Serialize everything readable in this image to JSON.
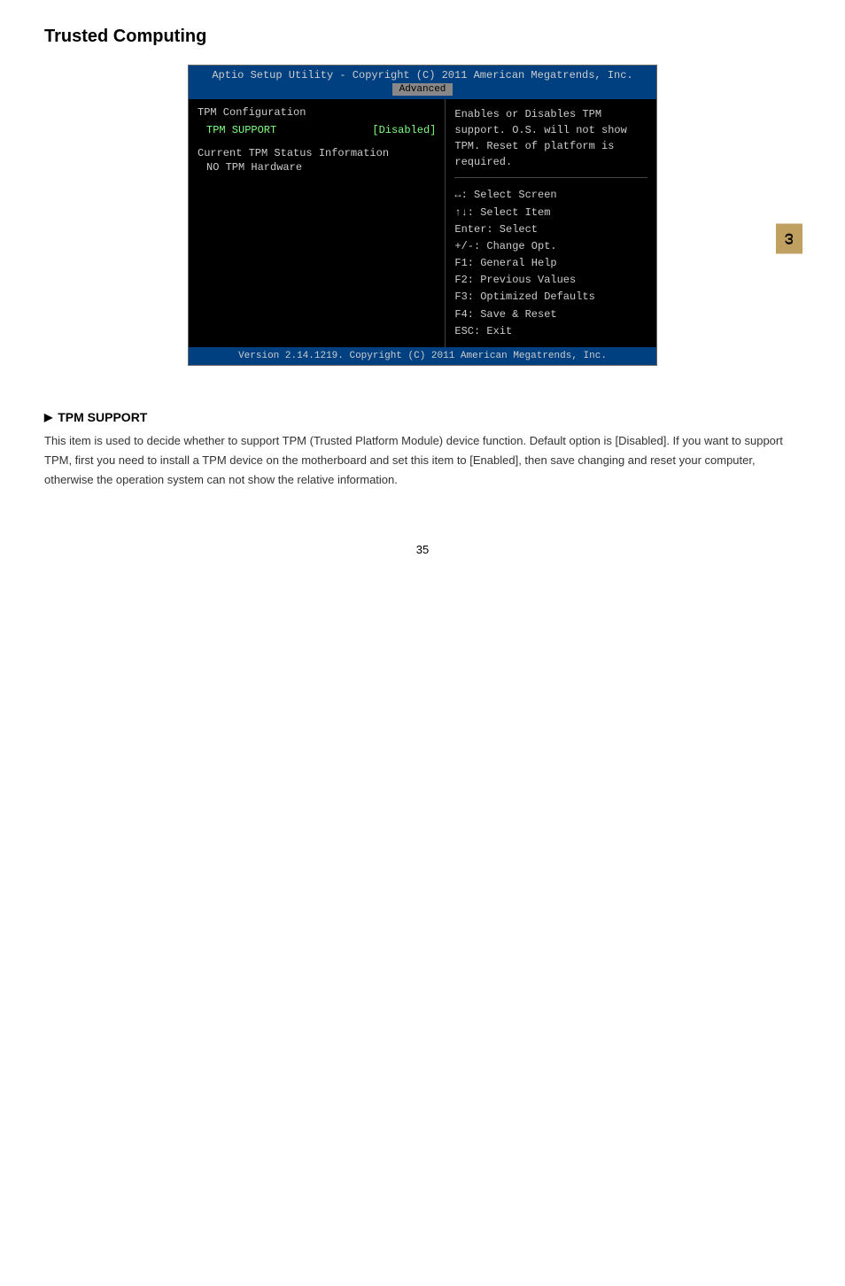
{
  "page": {
    "title": "Trusted Computing",
    "side_tab_label": "ω",
    "page_number": "35"
  },
  "bios": {
    "header_title": "Aptio Setup Utility - Copyright (C) 2011 American Megatrends, Inc.",
    "active_tab": "Advanced",
    "left_panel": {
      "section_title": "TPM Configuration",
      "tpm_support_label": "TPM SUPPORT",
      "tpm_support_value": "[Disabled]",
      "status_section_title": "Current TPM Status Information",
      "status_value": "NO TPM Hardware"
    },
    "right_panel": {
      "description_line1": "Enables or Disables TPM",
      "description_line2": "support. O.S. will not show",
      "description_line3": "TPM. Reset of platform is",
      "description_line4": "required.",
      "help_line1": "↔: Select Screen",
      "help_line2": "↑↓: Select Item",
      "help_line3": "Enter: Select",
      "help_line4": "+/-: Change Opt.",
      "help_line5": "F1: General Help",
      "help_line6": "F2: Previous Values",
      "help_line7": "F3: Optimized Defaults",
      "help_line8": "F4: Save & Reset",
      "help_line9": "ESC: Exit"
    },
    "footer_text": "Version 2.14.1219. Copyright (C) 2011 American Megatrends, Inc."
  },
  "tpm_support_section": {
    "heading": "TPM SUPPORT",
    "description": "This item is used to decide whether to support TPM (Trusted Platform Module) device function. Default option is [Disabled]. If you want to support TPM, first you need to install a TPM device on the motherboard and set this item to [Enabled], then save changing and reset your computer, otherwise the operation system can not show the relative information."
  }
}
